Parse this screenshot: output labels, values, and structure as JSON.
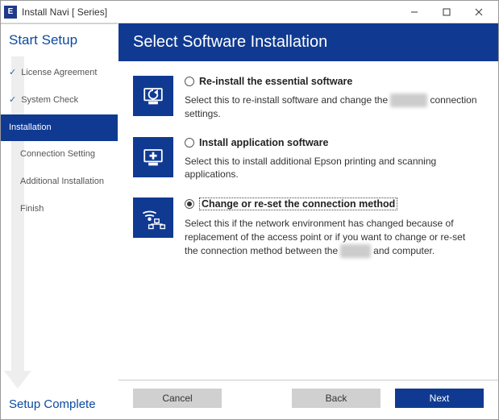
{
  "titlebar": {
    "icon_letter": "E",
    "title": "Install Navi [        Series]"
  },
  "sidebar": {
    "top": "Start Setup",
    "steps": [
      {
        "label": "License Agreement",
        "done": true,
        "active": false
      },
      {
        "label": "System Check",
        "done": true,
        "active": false
      },
      {
        "label": "Installation",
        "done": false,
        "active": true
      },
      {
        "label": "Connection Setting",
        "done": false,
        "active": false
      },
      {
        "label": "Additional Installation",
        "done": false,
        "active": false
      },
      {
        "label": "Finish",
        "done": false,
        "active": false
      }
    ],
    "bottom": "Setup Complete"
  },
  "main": {
    "heading": "Select Software Installation",
    "options": [
      {
        "key": "reinstall",
        "title": "Re-install the essential software",
        "desc_pre": "Select this to re-install software and change the ",
        "desc_blur": "Printer's",
        "desc_post": " connection settings.",
        "selected": false
      },
      {
        "key": "install-apps",
        "title": "Install application software",
        "desc_pre": "Select this to install additional Epson printing and scanning applications.",
        "desc_blur": "",
        "desc_post": "",
        "selected": false
      },
      {
        "key": "change-connection",
        "title": "Change or re-set the connection method",
        "desc_pre": "Select this if the network environment has changed because of replacement of the access point or if you want to change or re-set the connection method between the ",
        "desc_blur": "Printer",
        "desc_post": " and computer.",
        "selected": true
      }
    ]
  },
  "footer": {
    "cancel": "Cancel",
    "back": "Back",
    "next": "Next"
  }
}
